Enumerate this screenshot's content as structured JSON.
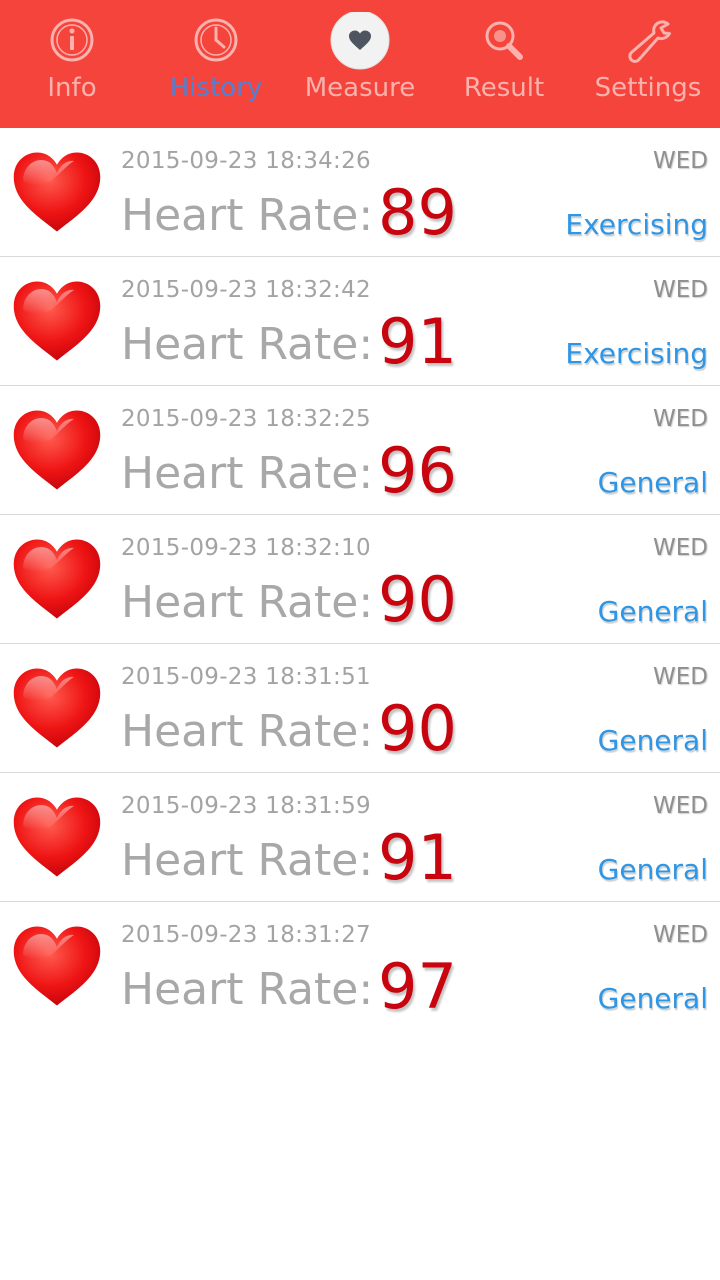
{
  "tabs": [
    {
      "label": "Info",
      "icon": "info-icon",
      "active": false
    },
    {
      "label": "History",
      "icon": "clock-icon",
      "active": true
    },
    {
      "label": "Measure",
      "icon": "heart-icon",
      "active": false
    },
    {
      "label": "Result",
      "icon": "magnifier-icon",
      "active": false
    },
    {
      "label": "Settings",
      "icon": "wrench-icon",
      "active": false
    }
  ],
  "records": [
    {
      "timestamp": "2015-09-23 18:34:26",
      "day": "WED",
      "label": "Heart Rate:",
      "value": "89",
      "state": "Exercising"
    },
    {
      "timestamp": "2015-09-23 18:32:42",
      "day": "WED",
      "label": "Heart Rate:",
      "value": "91",
      "state": "Exercising"
    },
    {
      "timestamp": "2015-09-23 18:32:25",
      "day": "WED",
      "label": "Heart Rate:",
      "value": "96",
      "state": "General"
    },
    {
      "timestamp": "2015-09-23 18:32:10",
      "day": "WED",
      "label": "Heart Rate:",
      "value": "90",
      "state": "General"
    },
    {
      "timestamp": "2015-09-23 18:31:51",
      "day": "WED",
      "label": "Heart Rate:",
      "value": "90",
      "state": "General"
    },
    {
      "timestamp": "2015-09-23 18:31:59",
      "day": "WED",
      "label": "Heart Rate:",
      "value": "91",
      "state": "General"
    },
    {
      "timestamp": "2015-09-23 18:31:27",
      "day": "WED",
      "label": "Heart Rate:",
      "value": "97",
      "state": "General"
    }
  ],
  "colors": {
    "tabbar_bg": "#f5443b",
    "tab_label": "#f9b2ad",
    "tab_active": "#4f82d6",
    "value": "#c8040f",
    "state": "#2d96e6"
  }
}
